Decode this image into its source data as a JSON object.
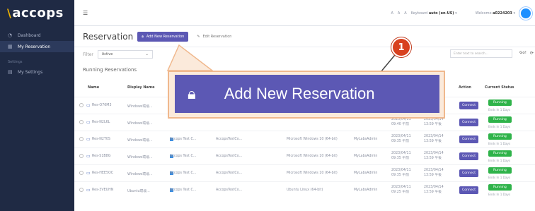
{
  "sidebar": {
    "logo": "accops",
    "items": [
      {
        "label": "Dashboard",
        "icon": "dashboard-icon"
      },
      {
        "label": "My Reservation",
        "icon": "calendar-icon"
      }
    ],
    "section": "Settings",
    "settings_item": {
      "label": "My Settings",
      "icon": "settings-icon"
    }
  },
  "topbar": {
    "font_sizes": [
      "A",
      "A",
      "A"
    ],
    "keyboard_label": "Keyboard",
    "keyboard_value": "auto (en-US)",
    "welcome_label": "Welcome",
    "user": "a0224203"
  },
  "page": {
    "title": "Reservation",
    "add_button": "Add New Reservation",
    "edit_button": "Edit Reservation",
    "filter_label": "Filter",
    "filter_value": "Active",
    "search_placeholder": "Enter text to search...",
    "go_label": "Go!",
    "section_title": "Running Reservations"
  },
  "table": {
    "columns": [
      "Name",
      "Display Name",
      "Action",
      "Current Status"
    ],
    "rows": [
      {
        "name": "Res-O76M3",
        "display": "Windows環境...",
        "template": "",
        "lab": "",
        "os": "",
        "owner": "",
        "start": "",
        "end": "2023/04/14",
        "action": "Connect",
        "status": "Running",
        "ends": "Ends In 1 Days"
      },
      {
        "name": "Res-N2L6L",
        "display": "Windows環境...",
        "template": "",
        "lab": "",
        "os": "",
        "owner": "",
        "start": "2023/04/11 09:40 午前",
        "end": "2023/04/14 13:59 午後",
        "action": "Connect",
        "status": "Running",
        "ends": "Ends In 1 Days"
      },
      {
        "name": "Res-N2T0S",
        "display": "Windows環境...",
        "template": "Accops Test C...",
        "lab": "AccopsTestCo...",
        "os": "Microsoft Windows 10 (64-bit)",
        "owner": "MyLabsAdmin",
        "start": "2023/04/11 09:35 午前",
        "end": "2023/04/14 13:59 午後",
        "action": "Connect",
        "status": "Running",
        "ends": "Ends In 1 Days"
      },
      {
        "name": "Res-S1B8G",
        "display": "Windows環境...",
        "template": "Accops Test C...",
        "lab": "AccopsTestCo...",
        "os": "Microsoft Windows 10 (64-bit)",
        "owner": "MyLabsAdmin",
        "start": "2023/04/11 09:35 午前",
        "end": "2023/04/14 13:59 午後",
        "action": "Connect",
        "status": "Running",
        "ends": "Ends In 1 Days"
      },
      {
        "name": "Res-HEE5OC",
        "display": "Windows環境...",
        "template": "Accops Test C...",
        "lab": "AccopsTestCo...",
        "os": "Microsoft Windows 10 (64-bit)",
        "owner": "MyLabsAdmin",
        "start": "2023/04/11 09:35 午前",
        "end": "2023/04/14 13:59 午後",
        "action": "Connect",
        "status": "Running",
        "ends": "Ends In 1 Days"
      },
      {
        "name": "Res-3VEUHN",
        "display": "Ubuntu環境...",
        "template": "Accops Test C...",
        "lab": "AccopsTestCo...",
        "os": "Ubuntu Linux (64-bit)",
        "owner": "MyLabsAdmin",
        "start": "2023/04/11 09:25 午前",
        "end": "2023/04/14 13:59 午後",
        "action": "Connect",
        "status": "Running",
        "ends": "Ends In 1 Days"
      }
    ]
  },
  "callout": {
    "number": "1",
    "zoom_label": "Add New Reservation"
  },
  "colors": {
    "primary": "#5c58b4",
    "running": "#2fb34a",
    "badge": "#d8411f",
    "sidebar": "#1f2a44"
  }
}
